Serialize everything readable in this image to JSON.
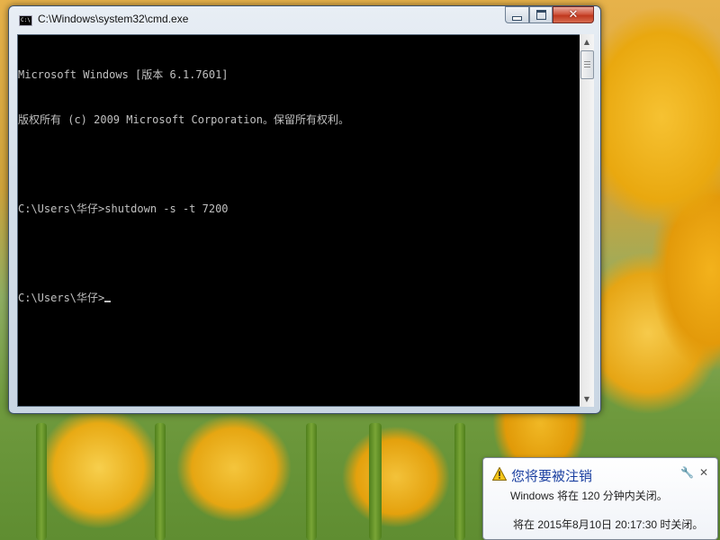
{
  "window": {
    "title": "C:\\Windows\\system32\\cmd.exe",
    "icon": "cmd-icon",
    "icon_text": "C:\\"
  },
  "console": {
    "lines": [
      "Microsoft Windows [版本 6.1.7601]",
      "版权所有 (c) 2009 Microsoft Corporation。保留所有权利。",
      "",
      "C:\\Users\\华仔>shutdown -s -t 7200",
      "",
      "C:\\Users\\华仔>"
    ]
  },
  "notification": {
    "title": "您将要被注销",
    "line1": "Windows 将在 120 分钟内关闭。",
    "line2": "将在 2015年8月10日 20:17:30 时关闭。",
    "icon": "warning-icon",
    "accent": "#1a3fa0"
  }
}
